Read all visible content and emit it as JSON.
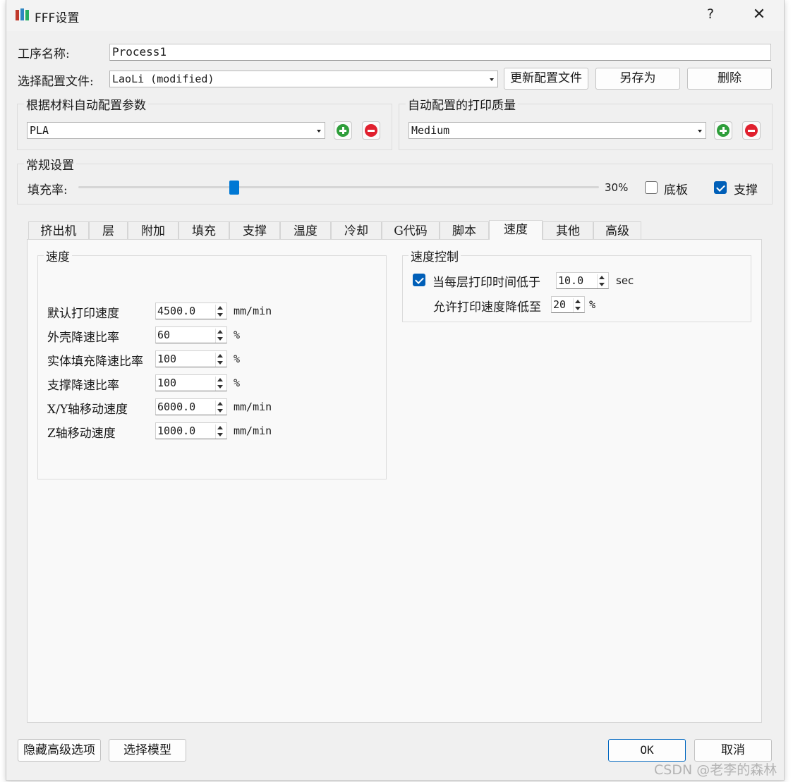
{
  "window": {
    "title": "FFF设置",
    "help": "?",
    "close": "✕"
  },
  "process": {
    "label": "工序名称:",
    "value": "Process1"
  },
  "profile": {
    "label": "选择配置文件:",
    "selected": "LaoLi (modified)",
    "update_button": "更新配置文件",
    "save_as_button": "另存为",
    "delete_button": "删除"
  },
  "material_group": {
    "title": "根据材料自动配置参数",
    "selected": "PLA"
  },
  "quality_group": {
    "title": "自动配置的打印质量",
    "selected": "Medium"
  },
  "general": {
    "title": "常规设置",
    "infill_label": "填充率:",
    "infill_value": "30%",
    "infill_fraction": 0.3,
    "raft_label": "底板",
    "raft_checked": false,
    "support_label": "支撑",
    "support_checked": true
  },
  "tabs": [
    "挤出机",
    "层",
    "附加",
    "填充",
    "支撑",
    "温度",
    "冷却",
    "G代码",
    "脚本",
    "速度",
    "其他",
    "高级"
  ],
  "active_tab": "速度",
  "speed_group": {
    "title": "速度",
    "rows": [
      {
        "label": "默认打印速度",
        "value": "4500.0",
        "unit": "mm/min"
      },
      {
        "label": "外壳降速比率",
        "value": "60",
        "unit": "%"
      },
      {
        "label": "实体填充降速比率",
        "value": "100",
        "unit": "%"
      },
      {
        "label": "支撑降速比率",
        "value": "100",
        "unit": "%"
      },
      {
        "label": "X/Y轴移动速度",
        "value": "6000.0",
        "unit": "mm/min"
      },
      {
        "label": "Z轴移动速度",
        "value": "1000.0",
        "unit": "mm/min"
      }
    ]
  },
  "speed_control": {
    "title": "速度控制",
    "slowdown_checked": true,
    "slowdown_label": "当每层打印时间低于",
    "slowdown_value": "10.0",
    "slowdown_unit": "sec",
    "allow_label": "允许打印速度降低至",
    "allow_value": "20",
    "allow_unit": "%"
  },
  "footer": {
    "hide_advanced_button": "隐藏高级选项",
    "select_model_button": "选择模型",
    "ok_button": "OK",
    "cancel_button": "取消"
  },
  "watermark": "CSDN @老李的森林",
  "colors": {
    "accent": "#005fb8",
    "add": "#2e9e3a",
    "remove": "#e0202e"
  }
}
